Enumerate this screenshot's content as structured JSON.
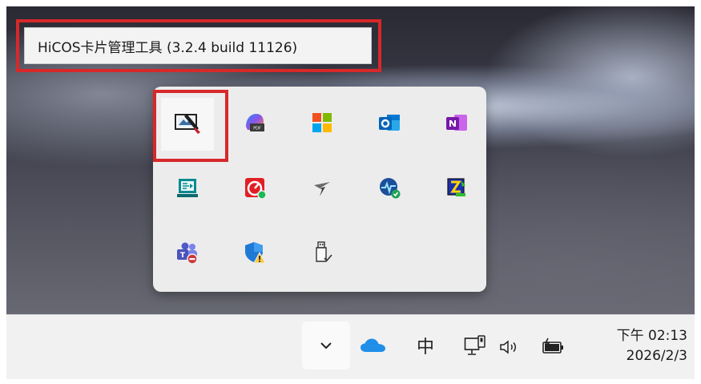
{
  "tooltip": {
    "text": "HiCOS卡片管理工具 (3.2.4 build 11126)"
  },
  "tray_icons": [
    "hicos-card-manager-icon",
    "copilot-icon",
    "microsoft-store-icon",
    "outlook-icon",
    "onenote-icon",
    "remote-app-icon",
    "speedtest-icon",
    "clipper-icon",
    "network-monitor-icon",
    "text-editor-icon",
    "teams-icon",
    "windows-security-warning-icon",
    "usb-safe-remove-icon"
  ],
  "taskbar": {
    "ime_label": "中",
    "clock_time": "下午 02:13",
    "clock_date": "2026/2/3"
  },
  "colors": {
    "highlight": "#d8282a",
    "onedrive": "#1f8fe8",
    "flyout_bg": "#ececec"
  }
}
